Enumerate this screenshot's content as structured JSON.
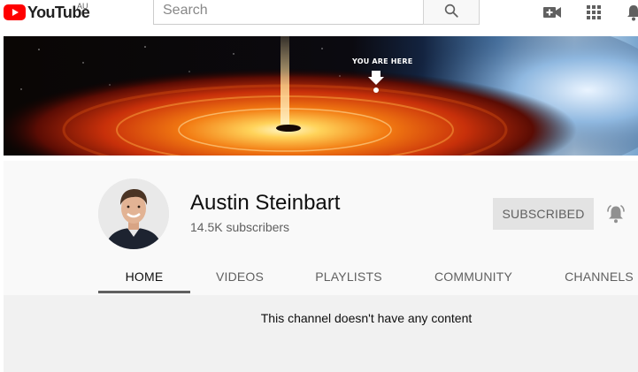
{
  "masthead": {
    "logo_text": "YouTube",
    "region": "AU",
    "search_placeholder": "Search",
    "icons": [
      "search-icon",
      "create-video-icon",
      "apps-grid-icon",
      "notifications-bell-icon"
    ]
  },
  "banner": {
    "caption": "YOU ARE HERE"
  },
  "channel": {
    "name": "Austin Steinbart",
    "subscribers": "14.5K subscribers",
    "subscribe_button": "SUBSCRIBED",
    "bell_icon": "notification-bell-icon"
  },
  "tabs": [
    {
      "label": "HOME",
      "active": true
    },
    {
      "label": "VIDEOS",
      "active": false
    },
    {
      "label": "PLAYLISTS",
      "active": false
    },
    {
      "label": "COMMUNITY",
      "active": false
    },
    {
      "label": "CHANNELS",
      "active": false
    }
  ],
  "content": {
    "empty_message": "This channel doesn't have any content"
  },
  "colors": {
    "brand_red": "#ff0000",
    "header_bg": "#f9f9f9",
    "content_bg": "#f1f1f1",
    "subscribed_bg": "#e3e3e3"
  }
}
